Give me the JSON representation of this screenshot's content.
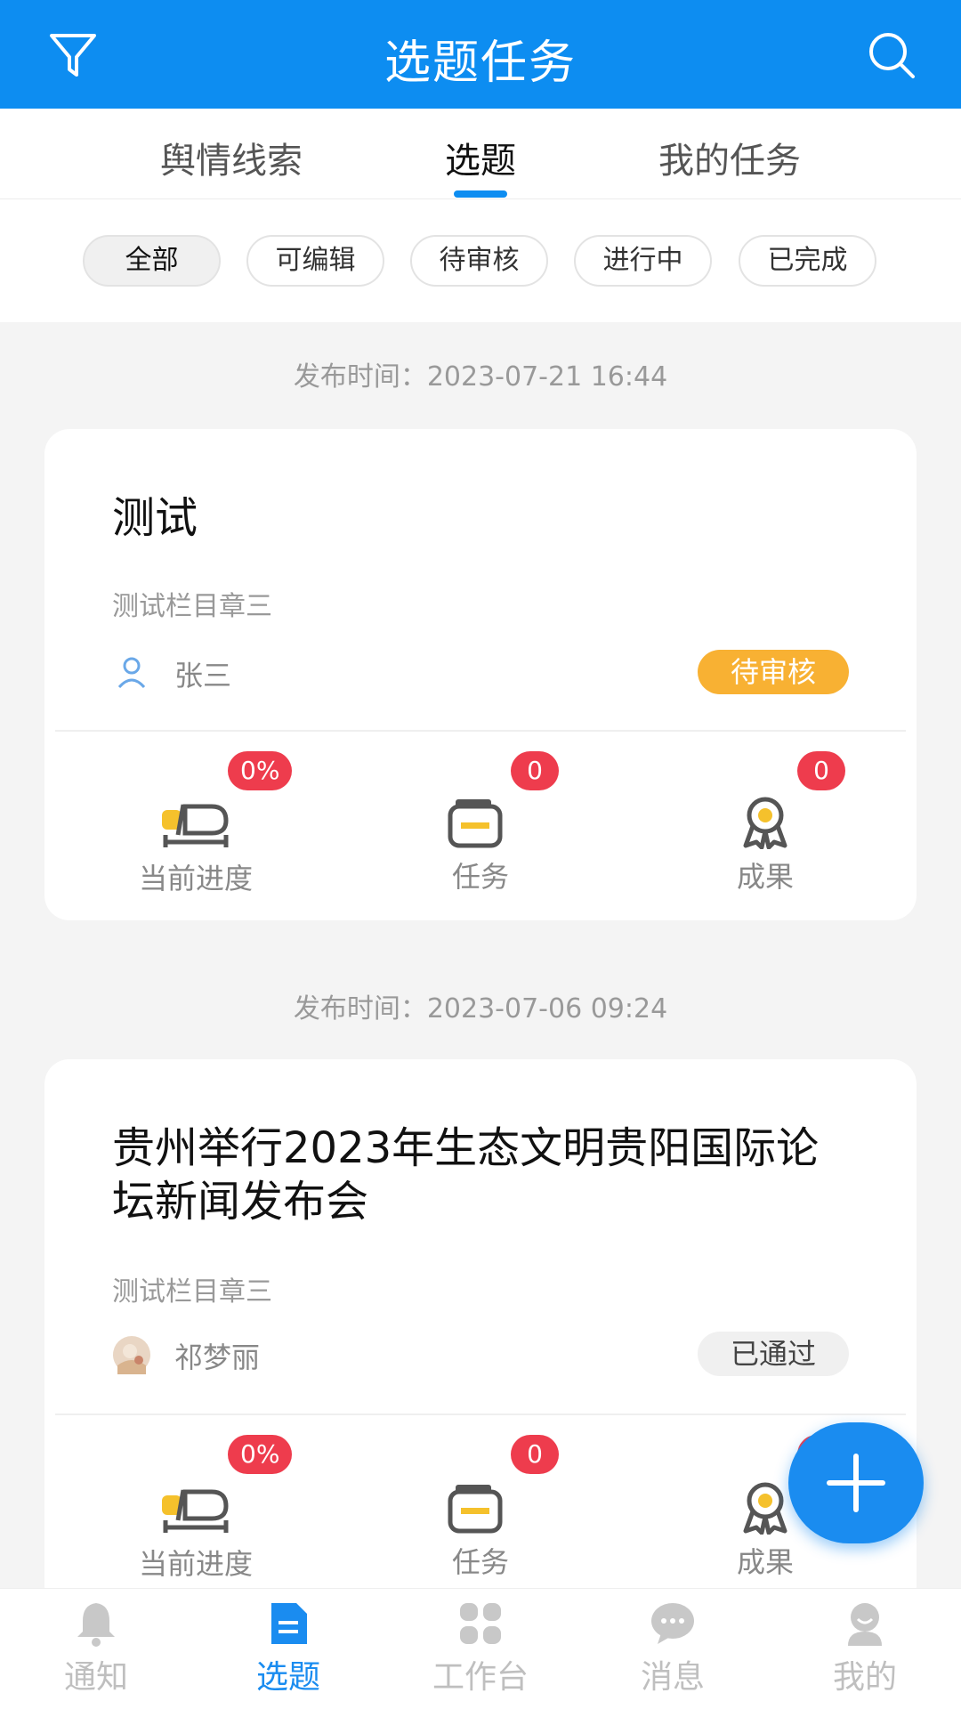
{
  "header": {
    "title": "选题任务",
    "filter_icon": "filter-icon",
    "search_icon": "search-icon",
    "color": "#0d8df1"
  },
  "tabs": [
    {
      "label": "舆情线索"
    },
    {
      "label": "选题",
      "active": true
    },
    {
      "label": "我的任务"
    }
  ],
  "filters": [
    {
      "label": "全部",
      "active": true
    },
    {
      "label": "可编辑"
    },
    {
      "label": "待审核"
    },
    {
      "label": "进行中"
    },
    {
      "label": "已完成"
    }
  ],
  "cards": [
    {
      "publish_time": "发布时间：2023-07-21 16:44",
      "title": "测试",
      "column": "测试栏目章三",
      "author": "张三",
      "status": "待审核",
      "status_color": "#f8b133",
      "stats": {
        "progress": {
          "label": "当前进度",
          "badge": "0%"
        },
        "tasks": {
          "label": "任务",
          "badge": "0"
        },
        "results": {
          "label": "成果",
          "badge": "0"
        }
      }
    },
    {
      "publish_time": "发布时间：2023-07-06 09:24",
      "title": "贵州举行2023年生态文明贵阳国际论坛新闻发布会",
      "column": "测试栏目章三",
      "author": "祁梦丽",
      "status": "已通过",
      "stats": {
        "progress": {
          "label": "当前进度",
          "badge": "0%"
        },
        "tasks": {
          "label": "任务",
          "badge": "0"
        },
        "results": {
          "label": "成果",
          "badge": ""
        }
      }
    }
  ],
  "fab": {
    "icon": "plus-icon"
  },
  "bottom_nav": [
    {
      "label": "通知",
      "icon": "bell-icon"
    },
    {
      "label": "选题",
      "icon": "document-icon",
      "active": true
    },
    {
      "label": "工作台",
      "icon": "grid-icon"
    },
    {
      "label": "消息",
      "icon": "chat-bubble-icon"
    },
    {
      "label": "我的",
      "icon": "profile-icon"
    }
  ]
}
